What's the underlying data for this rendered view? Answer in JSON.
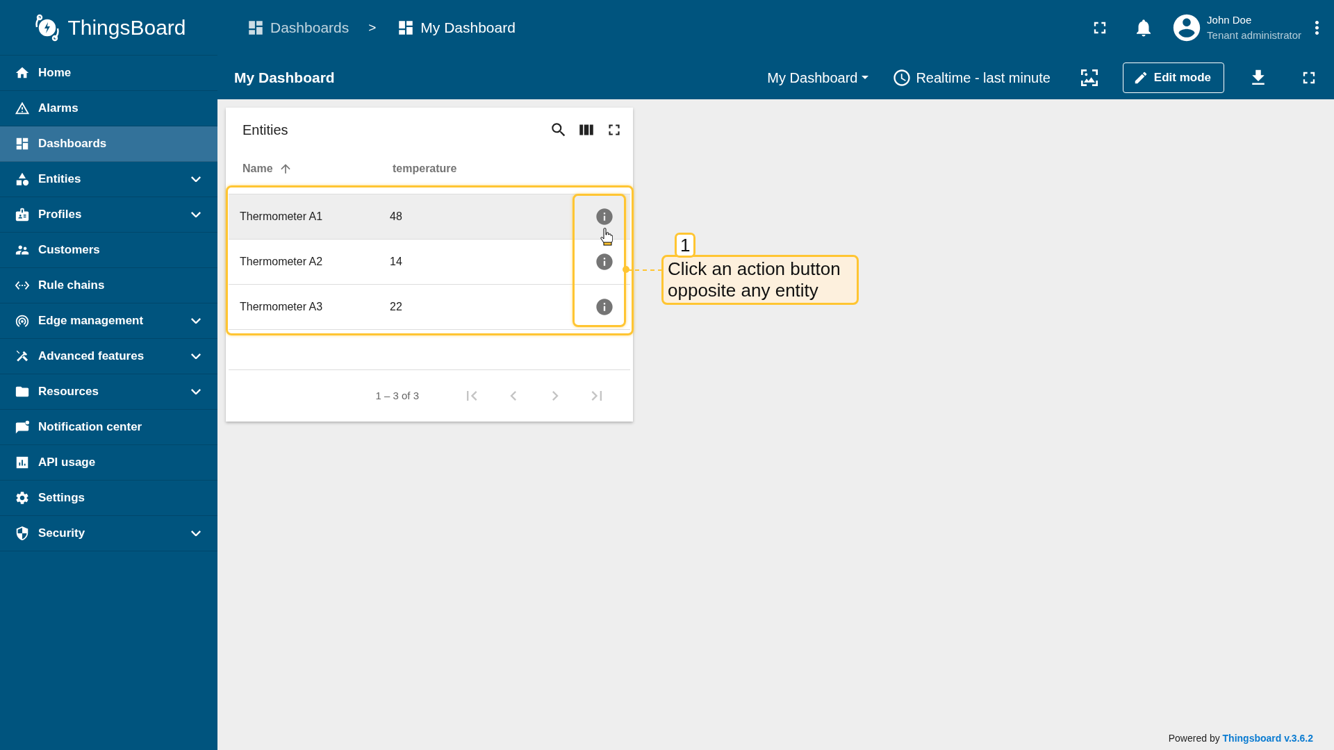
{
  "app": {
    "logo_text": "ThingsBoard"
  },
  "breadcrumb": [
    {
      "label": "Dashboards",
      "current": false
    },
    {
      "label": "My Dashboard",
      "current": true
    }
  ],
  "breadcrumb_separator": ">",
  "user": {
    "name": "John Doe",
    "role": "Tenant administrator"
  },
  "sidebar": {
    "items": [
      {
        "label": "Home",
        "expandable": false,
        "selected": false
      },
      {
        "label": "Alarms",
        "expandable": false,
        "selected": false
      },
      {
        "label": "Dashboards",
        "expandable": false,
        "selected": true
      },
      {
        "label": "Entities",
        "expandable": true,
        "selected": false
      },
      {
        "label": "Profiles",
        "expandable": true,
        "selected": false
      },
      {
        "label": "Customers",
        "expandable": false,
        "selected": false
      },
      {
        "label": "Rule chains",
        "expandable": false,
        "selected": false
      },
      {
        "label": "Edge management",
        "expandable": true,
        "selected": false
      },
      {
        "label": "Advanced features",
        "expandable": true,
        "selected": false
      },
      {
        "label": "Resources",
        "expandable": true,
        "selected": false
      },
      {
        "label": "Notification center",
        "expandable": false,
        "selected": false
      },
      {
        "label": "API usage",
        "expandable": false,
        "selected": false
      },
      {
        "label": "Settings",
        "expandable": false,
        "selected": false
      },
      {
        "label": "Security",
        "expandable": true,
        "selected": false
      }
    ]
  },
  "toolbar": {
    "title": "My Dashboard",
    "dashboard_select": "My Dashboard",
    "timewindow": "Realtime - last minute",
    "edit_button": "Edit mode"
  },
  "widget": {
    "title": "Entities",
    "columns": [
      {
        "label": "Name",
        "sorted": true
      },
      {
        "label": "temperature",
        "sorted": false
      }
    ],
    "rows": [
      {
        "name": "Thermometer A1",
        "temperature": "48",
        "hovered": true
      },
      {
        "name": "Thermometer A2",
        "temperature": "14",
        "hovered": false
      },
      {
        "name": "Thermometer A3",
        "temperature": "22",
        "hovered": false
      }
    ],
    "paginator": {
      "range": "1 – 3 of 3",
      "first_disabled": true,
      "prev_disabled": true,
      "next_disabled": true,
      "last_disabled": true
    }
  },
  "callout": {
    "number": "1",
    "text": "Click an action button opposite any entity"
  },
  "footer": {
    "prefix": "Powered by",
    "link": "Thingsboard v.3.6.2"
  }
}
